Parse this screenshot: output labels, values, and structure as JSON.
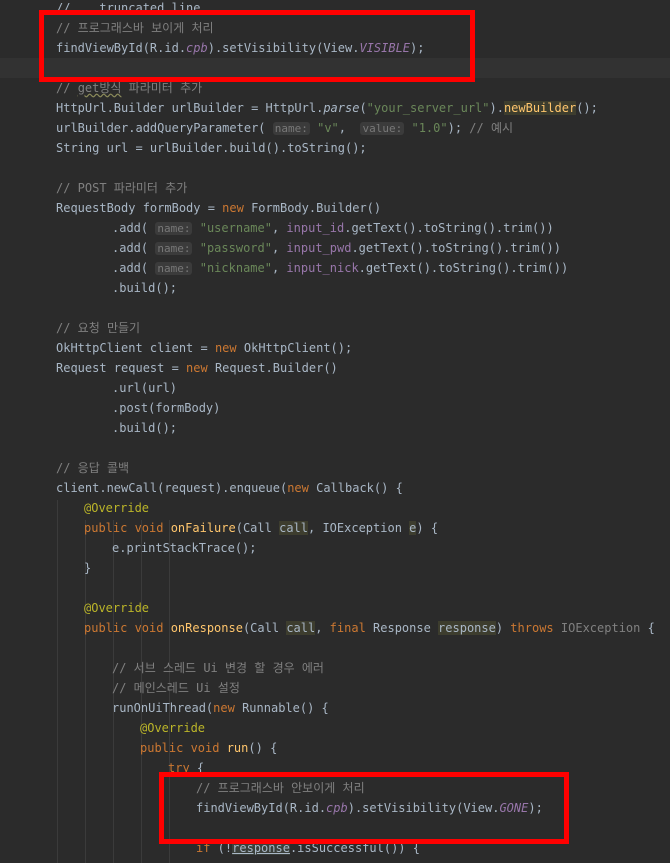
{
  "editor": {
    "indent_guides": [
      57,
      85,
      113,
      141,
      169
    ],
    "lines": [
      {
        "indent": 0,
        "tokens": [
          {
            "t": "plain",
            "s": "// "
          },
          {
            "t": "plain",
            "s": "...truncated line..."
          }
        ]
      },
      {
        "indent": 0,
        "tokens": [
          {
            "t": "comment",
            "s": "// 프로그래스바 보이게 처리"
          }
        ]
      },
      {
        "indent": 0,
        "tokens": [
          {
            "t": "plain",
            "s": "findViewById(R.id."
          },
          {
            "t": "field",
            "s": "cpb"
          },
          {
            "t": "plain",
            "s": ").setVisibility(View."
          },
          {
            "t": "field",
            "s": "VISIBLE"
          },
          {
            "t": "plain",
            "s": ");"
          }
        ]
      },
      {
        "indent": 0,
        "tokens": []
      },
      {
        "indent": 0,
        "tokens": [
          {
            "t": "comment",
            "s": "// "
          },
          {
            "t": "comment_squiggle",
            "s": "get방식"
          },
          {
            "t": "comment",
            "s": " 파라미터 추가"
          }
        ]
      },
      {
        "indent": 0,
        "tokens": [
          {
            "t": "plain",
            "s": "HttpUrl.Builder urlBuilder = HttpUrl."
          },
          {
            "t": "static",
            "s": "parse"
          },
          {
            "t": "plain",
            "s": "("
          },
          {
            "t": "str",
            "s": "\"your_server_url\""
          },
          {
            "t": "plain",
            "s": ")."
          },
          {
            "t": "method_hl",
            "s": "newBuilder"
          },
          {
            "t": "plain",
            "s": "();"
          }
        ]
      },
      {
        "indent": 0,
        "tokens": [
          {
            "t": "plain",
            "s": "urlBuilder.addQueryParameter( "
          },
          {
            "t": "hint",
            "s": "name:"
          },
          {
            "t": "plain",
            "s": " "
          },
          {
            "t": "str",
            "s": "\"v\""
          },
          {
            "t": "plain",
            "s": ",  "
          },
          {
            "t": "hint",
            "s": "value:"
          },
          {
            "t": "plain",
            "s": " "
          },
          {
            "t": "str",
            "s": "\"1.0\""
          },
          {
            "t": "plain",
            "s": "); "
          },
          {
            "t": "comment",
            "s": "// 예시"
          }
        ]
      },
      {
        "indent": 0,
        "tokens": [
          {
            "t": "plain",
            "s": "String url = urlBuilder.build().toString();"
          }
        ]
      },
      {
        "indent": 0,
        "tokens": []
      },
      {
        "indent": 0,
        "tokens": [
          {
            "t": "comment",
            "s": "// POST 파라미터 추가"
          }
        ]
      },
      {
        "indent": 0,
        "tokens": [
          {
            "t": "plain",
            "s": "RequestBody formBody = "
          },
          {
            "t": "kw",
            "s": "new"
          },
          {
            "t": "plain",
            "s": " FormBody.Builder()"
          }
        ]
      },
      {
        "indent": 2,
        "tokens": [
          {
            "t": "plain",
            "s": ".add( "
          },
          {
            "t": "hint",
            "s": "name:"
          },
          {
            "t": "plain",
            "s": " "
          },
          {
            "t": "str",
            "s": "\"username\""
          },
          {
            "t": "plain",
            "s": ", "
          },
          {
            "t": "field_plain",
            "s": "input_id"
          },
          {
            "t": "plain",
            "s": ".getText().toString().trim())"
          }
        ]
      },
      {
        "indent": 2,
        "tokens": [
          {
            "t": "plain",
            "s": ".add( "
          },
          {
            "t": "hint",
            "s": "name:"
          },
          {
            "t": "plain",
            "s": " "
          },
          {
            "t": "str",
            "s": "\"password\""
          },
          {
            "t": "plain",
            "s": ", "
          },
          {
            "t": "field_plain",
            "s": "input_pwd"
          },
          {
            "t": "plain",
            "s": ".getText().toString().trim())"
          }
        ]
      },
      {
        "indent": 2,
        "tokens": [
          {
            "t": "plain",
            "s": ".add( "
          },
          {
            "t": "hint",
            "s": "name:"
          },
          {
            "t": "plain",
            "s": " "
          },
          {
            "t": "str",
            "s": "\"nickname\""
          },
          {
            "t": "plain",
            "s": ", "
          },
          {
            "t": "field_plain",
            "s": "input_nick"
          },
          {
            "t": "plain",
            "s": ".getText().toString().trim())"
          }
        ]
      },
      {
        "indent": 2,
        "tokens": [
          {
            "t": "plain",
            "s": ".build();"
          }
        ]
      },
      {
        "indent": 0,
        "tokens": []
      },
      {
        "indent": 0,
        "tokens": [
          {
            "t": "comment",
            "s": "// 요청 만들기"
          }
        ]
      },
      {
        "indent": 0,
        "tokens": [
          {
            "t": "plain",
            "s": "OkHttpClient client = "
          },
          {
            "t": "kw",
            "s": "new"
          },
          {
            "t": "plain",
            "s": " OkHttpClient();"
          }
        ]
      },
      {
        "indent": 0,
        "tokens": [
          {
            "t": "plain",
            "s": "Request request = "
          },
          {
            "t": "kw",
            "s": "new"
          },
          {
            "t": "plain",
            "s": " Request.Builder()"
          }
        ]
      },
      {
        "indent": 2,
        "tokens": [
          {
            "t": "plain",
            "s": ".url(url)"
          }
        ]
      },
      {
        "indent": 2,
        "tokens": [
          {
            "t": "plain",
            "s": ".post(formBody)"
          }
        ]
      },
      {
        "indent": 2,
        "tokens": [
          {
            "t": "plain",
            "s": ".build();"
          }
        ]
      },
      {
        "indent": 0,
        "tokens": []
      },
      {
        "indent": 0,
        "tokens": [
          {
            "t": "comment",
            "s": "// 응답 콜백"
          }
        ]
      },
      {
        "indent": 0,
        "tokens": [
          {
            "t": "plain",
            "s": "client.newCall(request).enqueue("
          },
          {
            "t": "kw",
            "s": "new"
          },
          {
            "t": "plain",
            "s": " Callback() {"
          }
        ]
      },
      {
        "indent": 1,
        "tokens": [
          {
            "t": "anno",
            "s": "@Override"
          }
        ]
      },
      {
        "indent": 1,
        "tokens": [
          {
            "t": "kw",
            "s": "public void "
          },
          {
            "t": "method",
            "s": "onFailure"
          },
          {
            "t": "plain",
            "s": "(Call "
          },
          {
            "t": "param",
            "s": "call"
          },
          {
            "t": "plain",
            "s": ", IOException "
          },
          {
            "t": "param",
            "s": "e"
          },
          {
            "t": "plain",
            "s": ") {"
          }
        ]
      },
      {
        "indent": 2,
        "tokens": [
          {
            "t": "plain",
            "s": "e.printStackTrace();"
          }
        ]
      },
      {
        "indent": 1,
        "tokens": [
          {
            "t": "plain",
            "s": "}"
          }
        ]
      },
      {
        "indent": 0,
        "tokens": []
      },
      {
        "indent": 1,
        "tokens": [
          {
            "t": "anno",
            "s": "@Override"
          }
        ]
      },
      {
        "indent": 1,
        "tokens": [
          {
            "t": "kw",
            "s": "public void "
          },
          {
            "t": "method",
            "s": "onResponse"
          },
          {
            "t": "plain",
            "s": "(Call "
          },
          {
            "t": "param",
            "s": "call"
          },
          {
            "t": "plain",
            "s": ", "
          },
          {
            "t": "kw",
            "s": "final"
          },
          {
            "t": "plain",
            "s": " Response "
          },
          {
            "t": "param",
            "s": "response"
          },
          {
            "t": "plain",
            "s": ") "
          },
          {
            "t": "kw",
            "s": "throws"
          },
          {
            "t": "plain",
            "s": " "
          },
          {
            "t": "dim",
            "s": "IOException"
          },
          {
            "t": "plain",
            "s": " {"
          }
        ]
      },
      {
        "indent": 0,
        "tokens": []
      },
      {
        "indent": 2,
        "tokens": [
          {
            "t": "comment",
            "s": "// 서브 스레드 Ui 변경 할 경우 에러"
          }
        ]
      },
      {
        "indent": 2,
        "tokens": [
          {
            "t": "comment",
            "s": "// 메인스레드 Ui 설정"
          }
        ]
      },
      {
        "indent": 2,
        "tokens": [
          {
            "t": "plain",
            "s": "runOnUiThread("
          },
          {
            "t": "kw",
            "s": "new"
          },
          {
            "t": "plain",
            "s": " Runnable() {"
          }
        ]
      },
      {
        "indent": 3,
        "tokens": [
          {
            "t": "anno",
            "s": "@Override"
          }
        ]
      },
      {
        "indent": 3,
        "tokens": [
          {
            "t": "kw",
            "s": "public void "
          },
          {
            "t": "method",
            "s": "run"
          },
          {
            "t": "plain",
            "s": "() {"
          }
        ]
      },
      {
        "indent": 4,
        "tokens": [
          {
            "t": "kw",
            "s": "try"
          },
          {
            "t": "plain",
            "s": " {"
          }
        ]
      },
      {
        "indent": 5,
        "tokens": [
          {
            "t": "comment",
            "s": "// 프로그래스바 안보이게 처리"
          }
        ]
      },
      {
        "indent": 5,
        "tokens": [
          {
            "t": "plain",
            "s": "findViewById(R.id."
          },
          {
            "t": "field",
            "s": "cpb"
          },
          {
            "t": "plain",
            "s": ").setVisibility(View."
          },
          {
            "t": "field",
            "s": "GONE"
          },
          {
            "t": "plain",
            "s": ");"
          }
        ]
      },
      {
        "indent": 0,
        "tokens": []
      },
      {
        "indent": 5,
        "tokens": [
          {
            "t": "kw",
            "s": "if"
          },
          {
            "t": "plain",
            "s": " (!"
          },
          {
            "t": "param_under",
            "s": "response"
          },
          {
            "t": "plain",
            "s": ".isSuccessful()) {"
          }
        ]
      }
    ]
  }
}
